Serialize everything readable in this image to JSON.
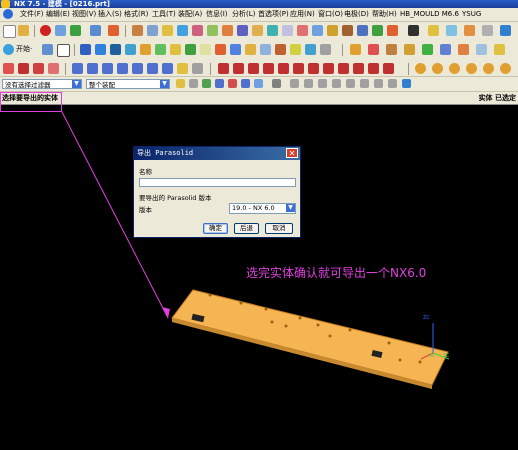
{
  "app": {
    "title": "NX 7.5 - 建模 - [0216.prt]"
  },
  "menu": [
    "文件(F)",
    "编辑(E)",
    "视图(V)",
    "插入(S)",
    "格式(R)",
    "工具(T)",
    "装配(A)",
    "信息(I)",
    "分析(L)",
    "首选项(P)",
    "应用(N)",
    "窗口(O)",
    "电极(D)",
    "帮助(H)",
    "HB_MOULD M6.6",
    "YSUG"
  ],
  "toolbar": {
    "start_label": "开始·"
  },
  "filters": {
    "type_filter": "没有选择过滤器",
    "scope_filter": "整个装配"
  },
  "cue": {
    "text": "选择要导出的实体"
  },
  "status": {
    "text": "实体 已选定"
  },
  "dialog": {
    "title": "导出 Parasolid",
    "name_label": "名称",
    "name_value": "",
    "section_label": "要导出的 Parasolid 版本",
    "version_label": "版本",
    "version_value": "19.0 - NX 6.0",
    "ok": "确定",
    "back": "后退",
    "cancel": "取消"
  },
  "annotation": {
    "text": "选完实体确认就可导出一个NX6.0"
  },
  "axes": {
    "z": "ZC",
    "x": "XC",
    "y": "YC"
  },
  "colors": {
    "part": "#f5b553",
    "annotation": "#e040e0",
    "background": "#000000"
  }
}
